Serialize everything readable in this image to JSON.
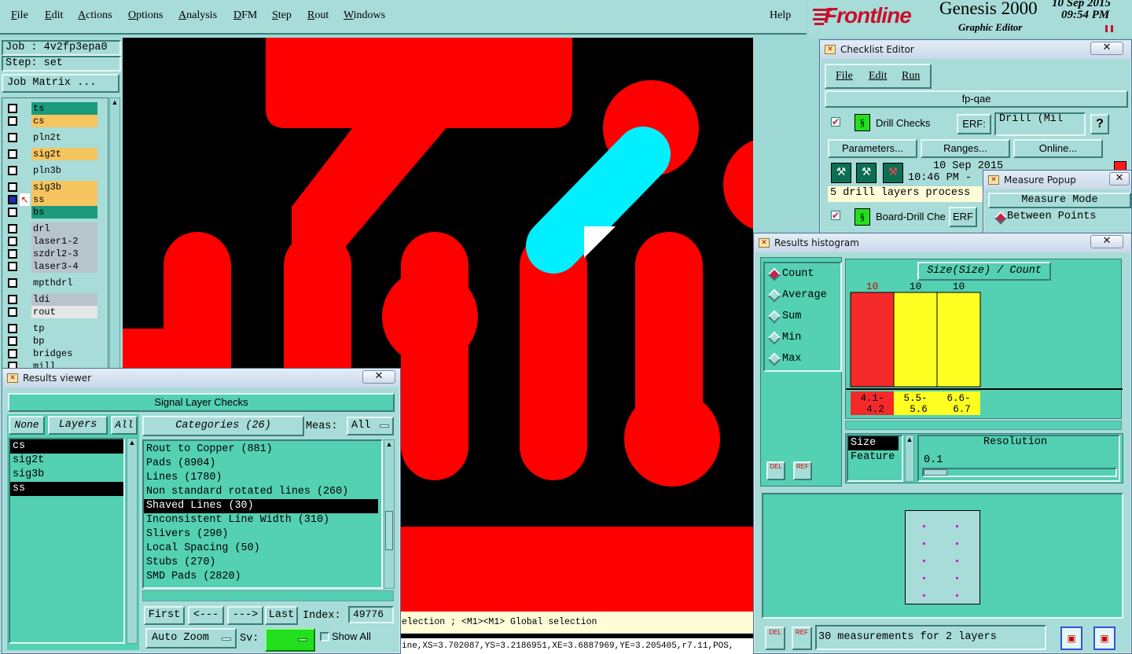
{
  "menu": {
    "items": [
      {
        "label": "File",
        "u": "F",
        "rest": "ile"
      },
      {
        "label": "Edit",
        "u": "E",
        "rest": "dit"
      },
      {
        "label": "Actions",
        "u": "A",
        "rest": "ctions"
      },
      {
        "label": "Options",
        "u": "O",
        "rest": "ptions"
      },
      {
        "label": "Analysis",
        "u": "A",
        "rest": "nalysis"
      },
      {
        "label": "DFM",
        "u": "D",
        "rest": "FM"
      },
      {
        "label": "Step",
        "u": "S",
        "rest": "tep"
      },
      {
        "label": "Rout",
        "u": "R",
        "rest": "out"
      },
      {
        "label": "Windows",
        "u": "W",
        "rest": "indows"
      }
    ],
    "help": "Help"
  },
  "brand": {
    "logo": "Frontline",
    "product": "Genesis 2000",
    "subtitle": "Graphic Editor",
    "date": "10 Sep 2015",
    "time": "09:54 PM",
    "logo_color": "#c8102e"
  },
  "job": {
    "job_label": "Job : 4v2fp3epa0",
    "step_label": "Step: set",
    "matrix_button": "Job Matrix ..."
  },
  "layers": [
    {
      "name": "ts",
      "color": "#1b9a7c"
    },
    {
      "name": "cs",
      "color": "#f5c560"
    },
    {
      "name": "pln2t",
      "color": "#a8dcd8"
    },
    {
      "name": "sig2t",
      "color": "#f5c560"
    },
    {
      "name": "pln3b",
      "color": "#a8dcd8"
    },
    {
      "name": "sig3b",
      "color": "#f5c560"
    },
    {
      "name": "ss",
      "color": "#f5c560",
      "work": true
    },
    {
      "name": "bs",
      "color": "#1b9a7c"
    },
    {
      "name": "drl",
      "color": "#b8c4cc"
    },
    {
      "name": "laser1-2",
      "color": "#b8c4cc"
    },
    {
      "name": "szdrl2-3",
      "color": "#b8c4cc"
    },
    {
      "name": "laser3-4",
      "color": "#b8c4cc"
    },
    {
      "name": "mpthdrl",
      "color": "#a8dcd8"
    },
    {
      "name": "ldi",
      "color": "#b8c4cc"
    },
    {
      "name": "rout",
      "color": "#e6e6e6"
    },
    {
      "name": "tp",
      "color": "#a8dcd8"
    },
    {
      "name": "bp",
      "color": "#a8dcd8"
    },
    {
      "name": "bridges",
      "color": "#a8dcd8"
    },
    {
      "name": "mill",
      "color": "#a8dcd8"
    }
  ],
  "results_viewer": {
    "title": "Results viewer",
    "close": "✕",
    "header": "Signal Layer Checks",
    "none_btn": "None",
    "layers_btn": "Layers",
    "all_btn": "All",
    "layer_list": [
      "cs",
      "sig2t",
      "sig3b",
      "ss"
    ],
    "categories_btn": "Categories (26)",
    "meas_label": "Meas:",
    "meas_value": "All",
    "categories": [
      "Rout to Copper (881)",
      "Pads (8904)",
      "Lines (1780)",
      "Non standard rotated lines (260)",
      "Shaved Lines (30)",
      "Inconsistent Line Width (310)",
      "Slivers (290)",
      "Local Spacing (50)",
      "Stubs (270)",
      "SMD Pads (2820)"
    ],
    "selected_category": 4,
    "first_btn": "First",
    "prev_btn": "<---",
    "next_btn": "--->",
    "last_btn": "Last",
    "index_label": "Index:",
    "index_value": "49776",
    "autozoom_btn": "Auto Zoom",
    "sv_label": "Sv:",
    "show_all": "Show All"
  },
  "status": {
    "selection_text": "election ; <M1><M1> Global selection",
    "coords_text": "ine,XS=3.702087,YS=3.2186951,XE=3.6887969,YE=3.205405,r7.11,POS,"
  },
  "checklist_editor": {
    "title": "Checklist Editor",
    "close": "✕",
    "menu": [
      "File",
      "Edit",
      "Run"
    ],
    "name": "fp-qae",
    "drill_checks": "Drill Checks",
    "erf_label": "ERF:",
    "erf_value": "Drill (Mil",
    "help_btn": "?",
    "parameters_btn": "Parameters...",
    "ranges_btn": "Ranges...",
    "online_btn": "Online...",
    "run_date": "10 Sep 2015",
    "run_time": "10:46 PM -",
    "drill_status": "5 drill layers process",
    "board_drill": "Board-Drill Che",
    "erf_short": "ERF"
  },
  "measure_popup": {
    "title": "Measure Popup",
    "close": "✕",
    "mode_label": "Measure Mode",
    "mode_value": "Between Points"
  },
  "histogram": {
    "title": "Results histogram",
    "close": "✕",
    "modes": [
      "Count",
      "Average",
      "Sum",
      "Min",
      "Max"
    ],
    "selected_mode": 0,
    "chart_title": "Size(Size) / Count",
    "del_btn": "DEL",
    "ref_btn": "REF",
    "attr_list": [
      "Size",
      "Feature"
    ],
    "resolution_label": "Resolution",
    "resolution_value": "0.1",
    "footer": "30 measurements for 2 layers"
  },
  "chart_data": {
    "type": "bar",
    "title": "Size(Size) / Count",
    "categories": [
      "4.1-4.2",
      "5.5-5.6",
      "6.6-6.7"
    ],
    "category_lines": [
      [
        "4.1-",
        "4.2"
      ],
      [
        "5.5-",
        "5.6"
      ],
      [
        "6.6-",
        "6.7"
      ]
    ],
    "values": [
      10,
      10,
      10
    ],
    "colors": [
      "#f42a2a",
      "#ffff22",
      "#ffff22"
    ],
    "label_colors": [
      "#d00000",
      "#000000",
      "#000000"
    ],
    "ylim": [
      0,
      10
    ]
  }
}
